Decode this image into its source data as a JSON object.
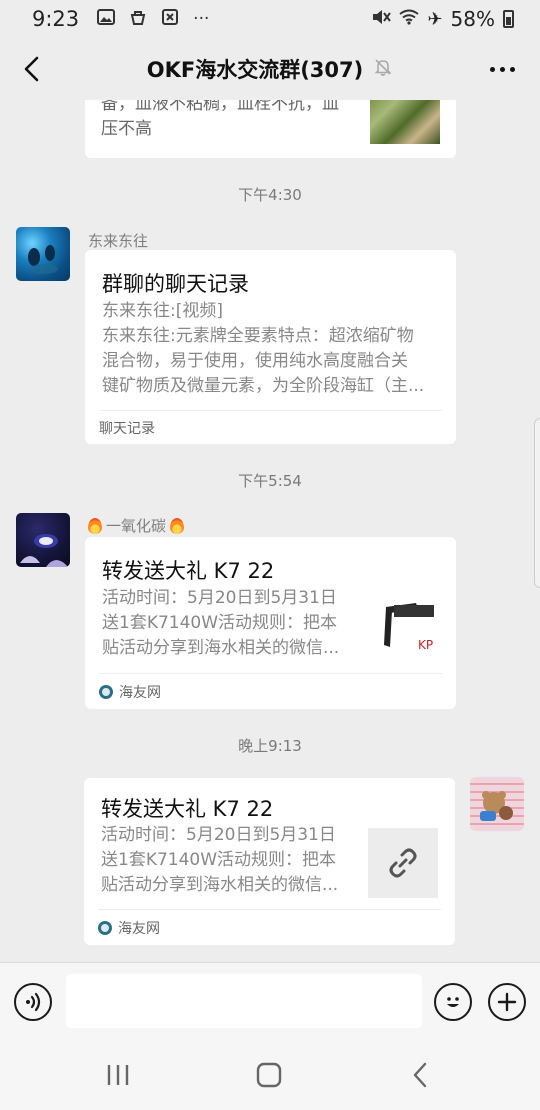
{
  "status_bar": {
    "time": "9:23",
    "battery": "58%",
    "left_icons": [
      "image-icon",
      "bag-icon",
      "sync-icon",
      "more-dots-icon"
    ],
    "right_icons": [
      "mute-icon",
      "wifi-icon",
      "airplane-icon",
      "battery-icon"
    ]
  },
  "nav": {
    "title": "OKF海水交流群(307)",
    "muted_icon": "bell-off-icon",
    "more_icon": "more-icon"
  },
  "messages": {
    "partial_card": {
      "line1": "备，血液不粘稠，血栓不抗，血",
      "line2": "压不高"
    },
    "time_1": "下午4:30",
    "chat_record": {
      "sender": "东来东往",
      "title": "群聊的聊天记录",
      "line1": "东来东往:[视频]",
      "line2": "东来东往:元素牌全要素特点：超浓缩矿物",
      "line3": "混合物，易于使用，使用纯水高度融合关",
      "line4": "键矿物质及微量元素，为全阶段海缸（主...",
      "footer": "聊天记录"
    },
    "time_2": "下午5:54",
    "link_card_1": {
      "sender": "一氧化碳",
      "title": "转发送大礼 K7 22",
      "line1": "活动时间：5月20日到5月31日",
      "line2": "送1套K7140W活动规则：把本",
      "line3": "贴活动分享到海水相关的微信...",
      "source": "海友网"
    },
    "time_3": "晚上9:13",
    "link_card_2": {
      "title": "转发送大礼 K7 22",
      "line1": "活动时间：5月20日到5月31日",
      "line2": "送1套K7140W活动规则：把本",
      "line3": "贴活动分享到海水相关的微信...",
      "source": "海友网"
    }
  },
  "input_bar": {
    "voice_icon": "voice-icon",
    "emoji_icon": "emoji-icon",
    "add_icon": "plus-icon",
    "placeholder": ""
  },
  "system_nav": {
    "recents_icon": "recents-icon",
    "home_icon": "home-icon",
    "back_icon": "back-icon"
  }
}
